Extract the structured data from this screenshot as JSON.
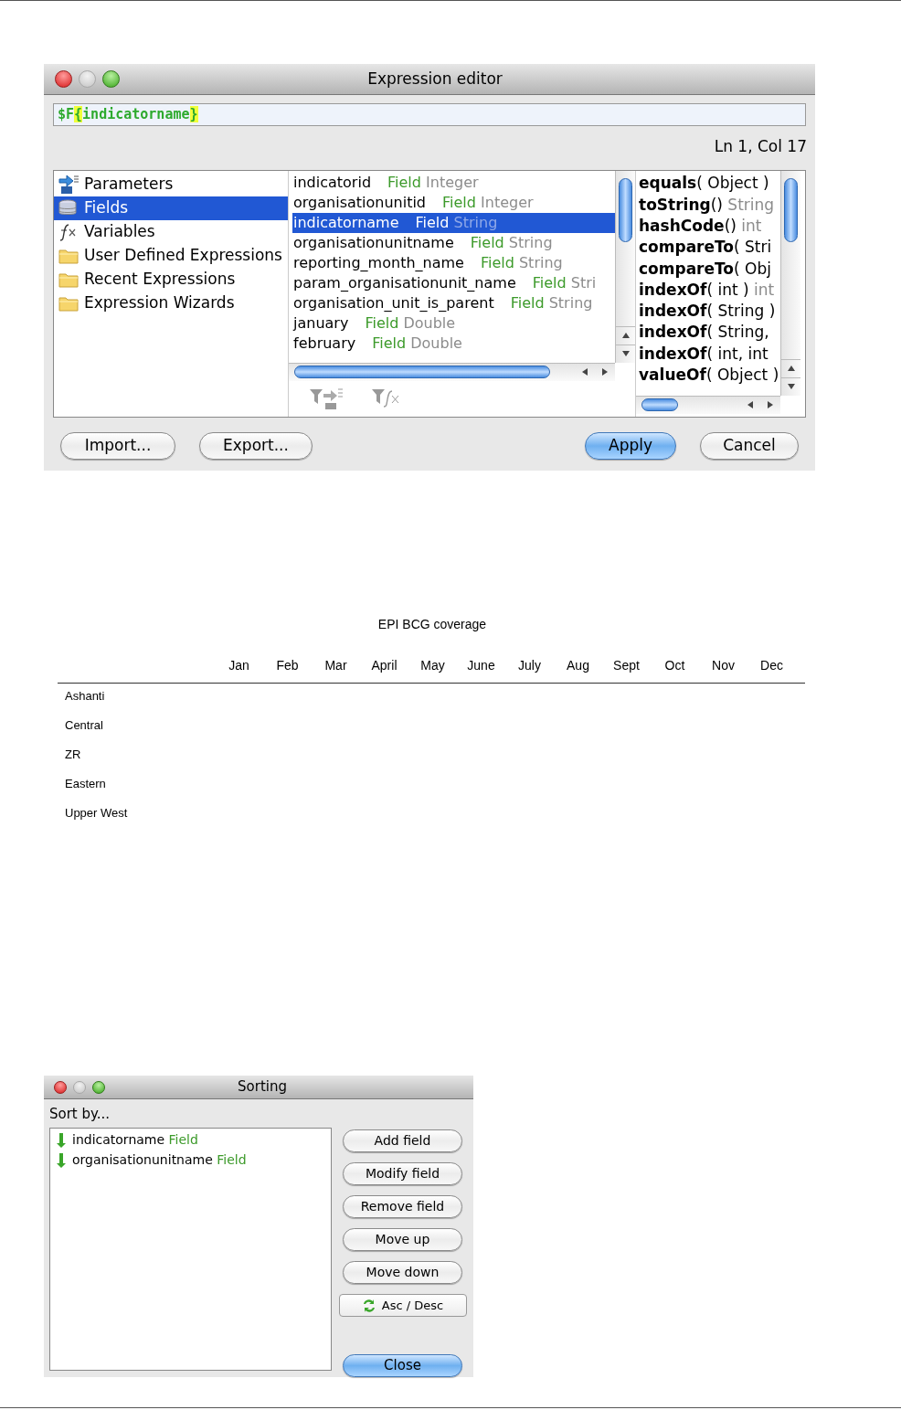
{
  "expression_editor": {
    "title": "Expression editor",
    "expression": {
      "prefix": "$F",
      "open": "{",
      "name": "indicatorname",
      "close": "}"
    },
    "cursor": "Ln 1, Col 17",
    "categories": [
      {
        "label": "Parameters",
        "kind": "parameters",
        "selected": false
      },
      {
        "label": "Fields",
        "kind": "fields",
        "selected": true
      },
      {
        "label": "Variables",
        "kind": "variables",
        "selected": false
      },
      {
        "label": "User Defined Expressions",
        "kind": "folder",
        "selected": false
      },
      {
        "label": "Recent Expressions",
        "kind": "folder",
        "selected": false
      },
      {
        "label": "Expression Wizards",
        "kind": "folder",
        "selected": false
      }
    ],
    "fields": [
      {
        "name": "indicatorid",
        "kind": "Field",
        "type": "Integer",
        "selected": false
      },
      {
        "name": "organisationunitid",
        "kind": "Field",
        "type": "Integer",
        "selected": false
      },
      {
        "name": "indicatorname",
        "kind": "Field",
        "type": "String",
        "selected": true
      },
      {
        "name": "organisationunitname",
        "kind": "Field",
        "type": "String",
        "selected": false
      },
      {
        "name": "reporting_month_name",
        "kind": "Field",
        "type": "String",
        "selected": false
      },
      {
        "name": "param_organisationunit_name",
        "kind": "Field",
        "type": "Stri",
        "selected": false
      },
      {
        "name": "organisation_unit_is_parent",
        "kind": "Field",
        "type": "String",
        "selected": false
      },
      {
        "name": "january",
        "kind": "Field",
        "type": "Double",
        "selected": false
      },
      {
        "name": "february",
        "kind": "Field",
        "type": "Double",
        "selected": false
      }
    ],
    "methods": [
      {
        "name": "equals",
        "rest": "( Object )"
      },
      {
        "name": "toString",
        "rest": "()",
        "type": "String"
      },
      {
        "name": "hashCode",
        "rest": "()",
        "type": "int"
      },
      {
        "name": "compareTo",
        "rest": "( Stri"
      },
      {
        "name": "compareTo",
        "rest": "( Obj"
      },
      {
        "name": "indexOf",
        "rest": "( int )",
        "type": "int"
      },
      {
        "name": "indexOf",
        "rest": "( String )"
      },
      {
        "name": "indexOf",
        "rest": "( String,"
      },
      {
        "name": "indexOf",
        "rest": "( int, int"
      },
      {
        "name": "valueOf",
        "rest": "( Object )"
      }
    ],
    "buttons": [
      {
        "label": "Import...",
        "default": false
      },
      {
        "label": "Export...",
        "default": false
      },
      {
        "label": "Apply",
        "default": true
      },
      {
        "label": "Cancel",
        "default": false
      }
    ]
  },
  "report": {
    "title": "EPI BCG coverage",
    "months": [
      "Jan",
      "Feb",
      "Mar",
      "April",
      "May",
      "June",
      "July",
      "Aug",
      "Sept",
      "Oct",
      "Nov",
      "Dec"
    ],
    "rows": [
      "Ashanti",
      "Central",
      "ZR",
      "Eastern",
      "Upper West"
    ]
  },
  "sorting": {
    "title": "Sorting",
    "label": "Sort by...",
    "items": [
      {
        "name": "indicatorname",
        "kind": "Field"
      },
      {
        "name": "organisationunitname",
        "kind": "Field"
      }
    ],
    "buttons": [
      {
        "label": "Add field",
        "default": false
      },
      {
        "label": "Modify field",
        "default": false
      },
      {
        "label": "Remove field",
        "default": false
      },
      {
        "label": "Move up",
        "default": false
      },
      {
        "label": "Move down",
        "default": false
      }
    ],
    "toggle": "Asc / Desc",
    "close": {
      "label": "Close",
      "default": true
    }
  }
}
